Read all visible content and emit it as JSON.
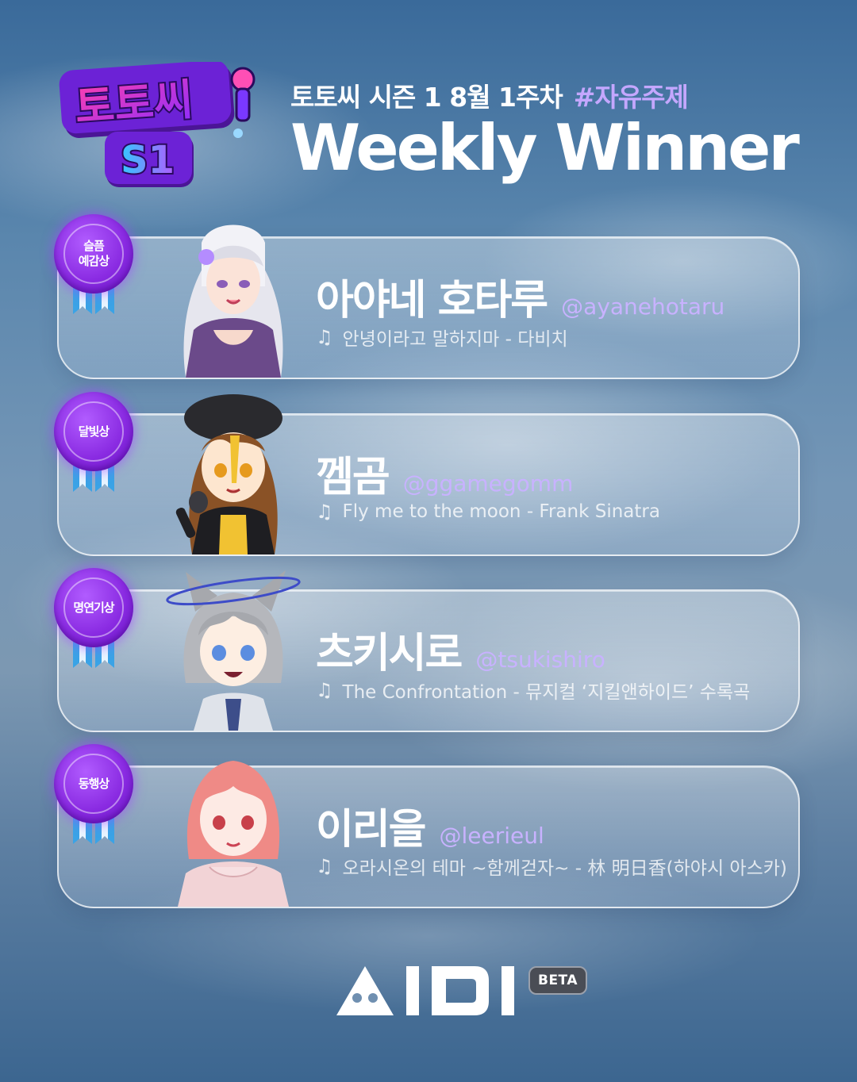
{
  "logo": {
    "line1": "토토씨",
    "line2": "S1"
  },
  "header": {
    "subtitle": "토토씨 시즌 1 8월 1주차",
    "tag": "#자유주제",
    "title": "Weekly Winner"
  },
  "winners": [
    {
      "award": "슬픔\n예감상",
      "name": "아야네 호타루",
      "handle": "@ayanehotaru",
      "song": "안녕이라고 말하지마 - 다비치"
    },
    {
      "award": "달빛상",
      "name": "껨곰",
      "handle": "@ggamegomm",
      "song": "Fly me to the moon - Frank Sinatra"
    },
    {
      "award": "명연기상",
      "name": "츠키시로",
      "handle": "@tsukishiro",
      "song": "The Confrontation - 뮤지컬 ‘지킬앤하이드’ 수록곡"
    },
    {
      "award": "동행상",
      "name": "이리을",
      "handle": "@leerieul",
      "song": "오라시온의 테마 ~함께걷자~ - 林 明日香(하야시 아스카)"
    }
  ],
  "icons": {
    "note": "♫",
    "mic": "microphone-icon",
    "ribbon": "award-ribbon-icon"
  },
  "footer": {
    "brand": "MIDI",
    "badge": "BETA"
  },
  "colors": {
    "accent_purple": "#c4a7ff",
    "medal_purple": "#8a2be2",
    "ribbon_blue": "#3aa3e6",
    "badge_gray": "#4a4d55"
  }
}
